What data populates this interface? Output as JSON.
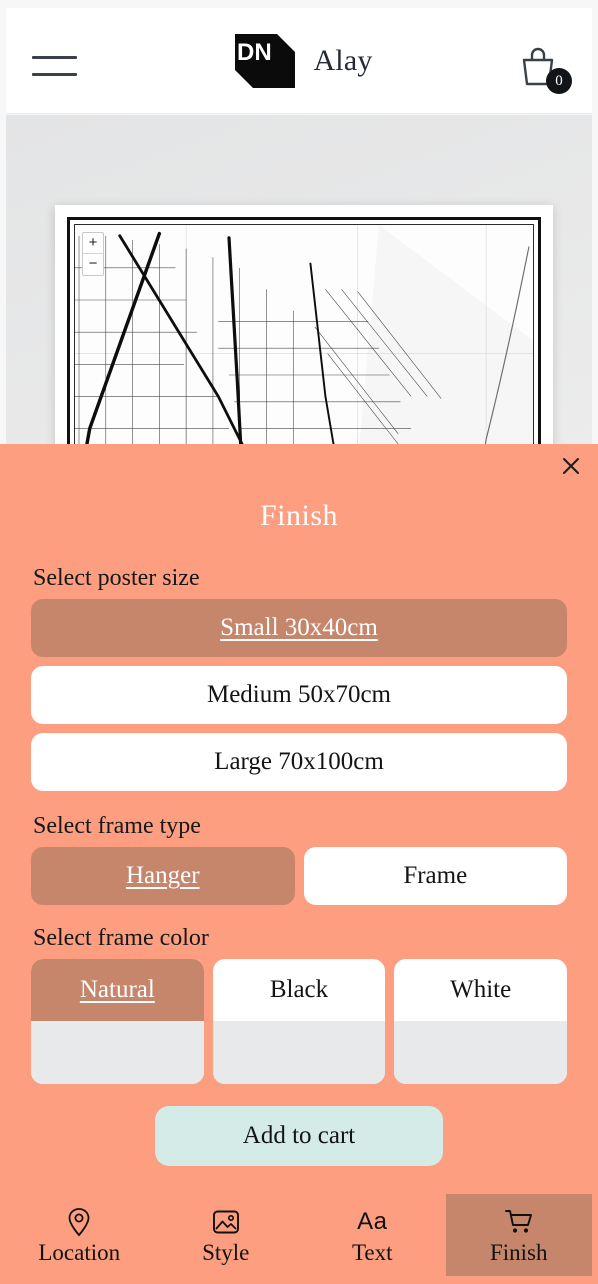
{
  "header": {
    "menu_icon": "hamburger-menu-icon",
    "logo_text": "DN",
    "brand_title": "Alay",
    "cart_icon": "shopping-bag-icon",
    "cart_count": "0"
  },
  "canvas": {
    "poster": {
      "zoom_in_label": "+",
      "zoom_out_label": "−",
      "map_style": "black-and-white-street-map"
    }
  },
  "sheet": {
    "title": "Finish",
    "close_icon": "close-icon",
    "size": {
      "label": "Select poster size",
      "options": [
        {
          "label": "Small 30x40cm",
          "selected": true
        },
        {
          "label": "Medium 50x70cm",
          "selected": false
        },
        {
          "label": "Large 70x100cm",
          "selected": false
        }
      ]
    },
    "frame_type": {
      "label": "Select frame type",
      "options": [
        {
          "label": "Hanger",
          "selected": true
        },
        {
          "label": "Frame",
          "selected": false
        }
      ]
    },
    "frame_color": {
      "label": "Select frame color",
      "options": [
        {
          "label": "Natural",
          "selected": true
        },
        {
          "label": "Black",
          "selected": false
        },
        {
          "label": "White",
          "selected": false
        }
      ]
    },
    "add_to_cart_label": "Add to cart"
  },
  "bottom_nav": {
    "items": [
      {
        "label": "Location",
        "icon": "map-pin-icon",
        "active": false
      },
      {
        "label": "Style",
        "icon": "image-icon",
        "active": false
      },
      {
        "label": "Text",
        "icon": "text-aa-icon",
        "active": false
      },
      {
        "label": "Finish",
        "icon": "shopping-cart-icon",
        "active": true
      }
    ]
  },
  "colors": {
    "sheet_background": "#fc9e7f",
    "selected_option": "#c6866b",
    "add_to_cart": "#d4ebe8",
    "swatch": "#e8e9eb",
    "canvas_background": "#e8e9ea",
    "text_dark": "#141414"
  }
}
